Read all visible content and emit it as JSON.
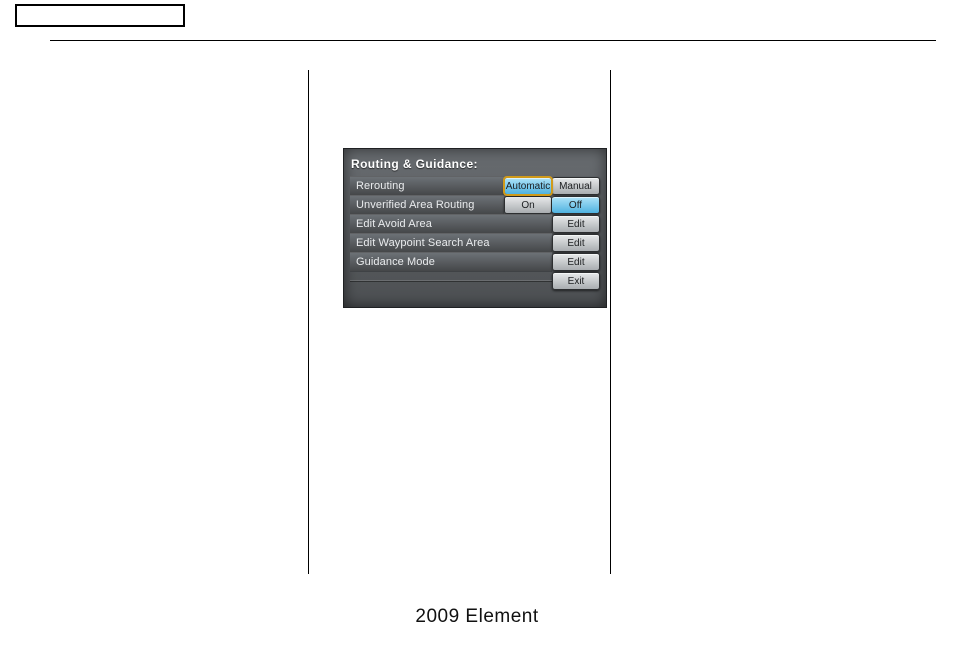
{
  "footer": {
    "caption": "2009  Element"
  },
  "nav_panel": {
    "title": "Routing & Guidance:",
    "rows": [
      {
        "label": "Rerouting",
        "buttons": [
          {
            "label": "Automatic",
            "blue": true,
            "selected": true
          },
          {
            "label": "Manual",
            "blue": false,
            "selected": false
          }
        ]
      },
      {
        "label": "Unverified Area Routing",
        "buttons": [
          {
            "label": "On",
            "blue": false,
            "selected": false
          },
          {
            "label": "Off",
            "blue": true,
            "selected": false
          }
        ]
      },
      {
        "label": "Edit Avoid Area",
        "buttons": [
          {
            "label": "Edit",
            "blue": false,
            "selected": false
          }
        ]
      },
      {
        "label": "Edit Waypoint Search Area",
        "buttons": [
          {
            "label": "Edit",
            "blue": false,
            "selected": false
          }
        ]
      },
      {
        "label": "Guidance Mode",
        "buttons": [
          {
            "label": "Edit",
            "blue": false,
            "selected": false
          }
        ]
      }
    ],
    "exit_label": "Exit"
  }
}
